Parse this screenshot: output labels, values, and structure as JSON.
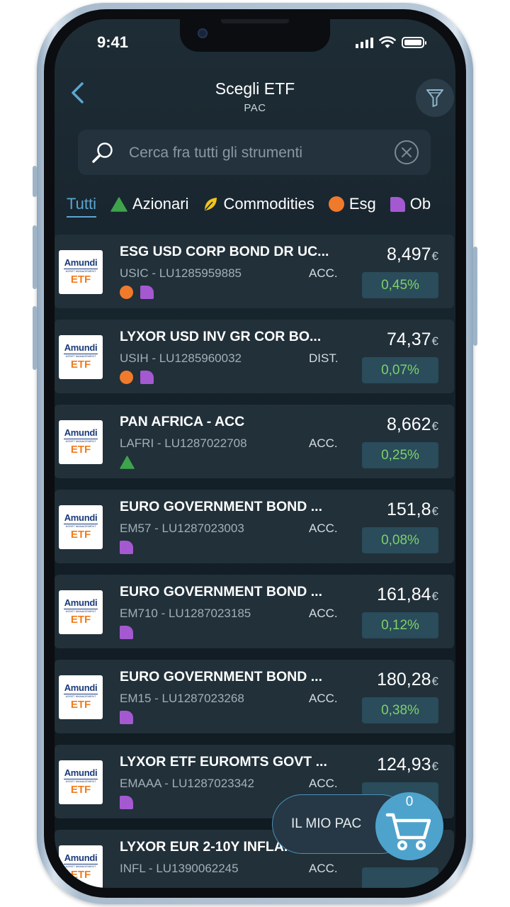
{
  "status": {
    "time": "9:41"
  },
  "header": {
    "title": "Scegli ETF",
    "subtitle": "PAC"
  },
  "search": {
    "placeholder": "Cerca fra tutti gli strumenti",
    "value": ""
  },
  "tabs": [
    {
      "label": "Tutti",
      "icon": "none",
      "active": true
    },
    {
      "label": "Azionari",
      "icon": "green-triangle-icon"
    },
    {
      "label": "Commodities",
      "icon": "yellow-leaf-icon"
    },
    {
      "label": "Esg",
      "icon": "orange-circle-icon"
    },
    {
      "label": "Ob",
      "icon": "purple-leaf-icon"
    }
  ],
  "currency_symbol": "€",
  "etfs": [
    {
      "logo": {
        "brand": "Amundi",
        "sub": "ASSET MANAGEMENT",
        "product": "ETF"
      },
      "name": "ESG USD CORP BOND DR UC...",
      "code": "USIC - LU1285959885",
      "distribution": "ACC.",
      "price": "8,497",
      "performance": "0,45%",
      "tags": [
        "esg",
        "bond"
      ]
    },
    {
      "logo": {
        "brand": "Amundi",
        "sub": "ASSET MANAGEMENT",
        "product": "ETF"
      },
      "name": "LYXOR USD INV GR COR BO...",
      "code": "USIH - LU1285960032",
      "distribution": "DIST.",
      "price": "74,37",
      "performance": "0,07%",
      "tags": [
        "esg",
        "bond"
      ]
    },
    {
      "logo": {
        "brand": "Amundi",
        "sub": "ASSET MANAGEMENT",
        "product": "ETF"
      },
      "name": "PAN AFRICA - ACC",
      "code": "LAFRI - LU1287022708",
      "distribution": "ACC.",
      "price": "8,662",
      "performance": "0,25%",
      "tags": [
        "equity"
      ]
    },
    {
      "logo": {
        "brand": "Amundi",
        "sub": "ASSET MANAGEMENT",
        "product": "ETF"
      },
      "name": "EURO GOVERNMENT BOND ...",
      "code": "EM57 - LU1287023003",
      "distribution": "ACC.",
      "price": "151,8",
      "performance": "0,08%",
      "tags": [
        "bond"
      ]
    },
    {
      "logo": {
        "brand": "Amundi",
        "sub": "ASSET MANAGEMENT",
        "product": "ETF"
      },
      "name": "EURO GOVERNMENT BOND ...",
      "code": "EM710 - LU1287023185",
      "distribution": "ACC.",
      "price": "161,84",
      "performance": "0,12%",
      "tags": [
        "bond"
      ]
    },
    {
      "logo": {
        "brand": "Amundi",
        "sub": "ASSET MANAGEMENT",
        "product": "ETF"
      },
      "name": "EURO GOVERNMENT BOND ...",
      "code": "EM15 - LU1287023268",
      "distribution": "ACC.",
      "price": "180,28",
      "performance": "0,38%",
      "tags": [
        "bond"
      ]
    },
    {
      "logo": {
        "brand": "Amundi",
        "sub": "ASSET MANAGEMENT",
        "product": "ETF"
      },
      "name": "LYXOR ETF EUROMTS GOVT ...",
      "code": "EMAAA - LU1287023342",
      "distribution": "ACC.",
      "price": "124,93",
      "performance": "",
      "tags": [
        "bond"
      ]
    },
    {
      "logo": {
        "brand": "Amundi",
        "sub": "ASSET MANAGEMENT",
        "product": "ETF"
      },
      "name": "LYXOR EUR 2-10Y INFLA...",
      "code": "INFL - LU1390062245",
      "distribution": "ACC.",
      "price": "",
      "performance": "",
      "tags": []
    }
  ],
  "pac_button": {
    "label": "IL MIO PAC",
    "count": "0"
  },
  "colors": {
    "accent": "#5aa6d0",
    "positive": "#7fd06b",
    "esg": "#f07a2c",
    "bond": "#a459d1",
    "equity": "#3fa34d",
    "commodity": "#f2c417"
  }
}
